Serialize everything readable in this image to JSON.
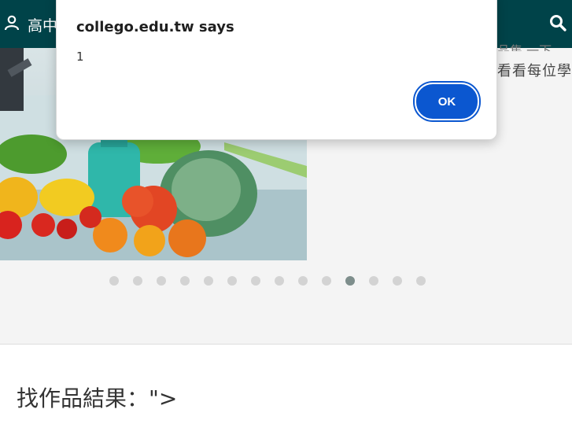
{
  "topbar": {
    "user_label": "高中",
    "user_icon": "user-icon",
    "search_icon": "search-icon",
    "color": "#004349"
  },
  "slide": {
    "side_text": "看看每位學",
    "side_text_top": "品集 一下"
  },
  "carousel": {
    "dot_count": 14,
    "active_index": 10,
    "dot_color": "#d3d3d3",
    "active_color": "#7e8e8c"
  },
  "result_heading": "找作品結果：\">",
  "dialog": {
    "title": "collego.edu.tw says",
    "message": "1",
    "ok_label": "OK",
    "button_color": "#0b57d0"
  }
}
